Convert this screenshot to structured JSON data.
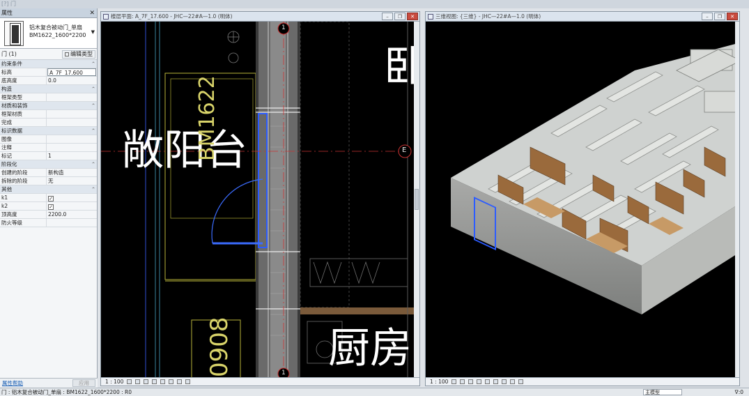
{
  "app": {
    "title": "[?] 门"
  },
  "properties": {
    "header": "属性",
    "type_name_line1": "铝木复合被动门_单扇",
    "type_name_line2": "BM1622_1600*2200",
    "instance_label": "门 (1)",
    "edit_type_label": "编辑类型",
    "help_label": "属性帮助",
    "apply_label": "应用",
    "rows": [
      {
        "kind": "section",
        "label": "约束条件"
      },
      {
        "kind": "param",
        "label": "标高",
        "value": "A_7F_17.600",
        "input": true
      },
      {
        "kind": "param",
        "label": "底高度",
        "value": "0.0"
      },
      {
        "kind": "section",
        "label": "构造"
      },
      {
        "kind": "param",
        "label": "框架类型",
        "value": ""
      },
      {
        "kind": "section",
        "label": "材质和装饰"
      },
      {
        "kind": "param",
        "label": "框架材质",
        "value": ""
      },
      {
        "kind": "param",
        "label": "完成",
        "value": ""
      },
      {
        "kind": "section",
        "label": "标识数据"
      },
      {
        "kind": "param",
        "label": "图像",
        "value": ""
      },
      {
        "kind": "param",
        "label": "注释",
        "value": ""
      },
      {
        "kind": "param",
        "label": "标记",
        "value": "1"
      },
      {
        "kind": "section",
        "label": "阶段化"
      },
      {
        "kind": "param",
        "label": "创建的阶段",
        "value": "新构造"
      },
      {
        "kind": "param",
        "label": "拆除的阶段",
        "value": "无"
      },
      {
        "kind": "section",
        "label": "其他"
      },
      {
        "kind": "check",
        "label": "k1",
        "checked": true
      },
      {
        "kind": "check",
        "label": "k2",
        "checked": true
      },
      {
        "kind": "param",
        "label": "顶高度",
        "value": "2200.0"
      },
      {
        "kind": "param",
        "label": "防火等级",
        "value": ""
      }
    ]
  },
  "plan_view": {
    "title": "楼层平面: A_7F_17.600 - JHC—22#A—1.0 (明体)",
    "scale": "1 : 100",
    "labels": {
      "balcony": "阳台",
      "balcony_partial": "敞",
      "bedroom_partial": "卧",
      "kitchen": "厨房",
      "door_tag": "BM1622",
      "window_tag": "0908",
      "grid_1": "1",
      "grid_e": "E"
    }
  },
  "view3d": {
    "title": "三维视图: {三维} - JHC—22#A—1.0 (明体)",
    "scale": "1 : 100"
  },
  "status": {
    "text": "门 : 铝木复合被动门_单扇 : BM1622_1600*2200 : R0",
    "selection": "∇:0",
    "model": "主模型"
  }
}
